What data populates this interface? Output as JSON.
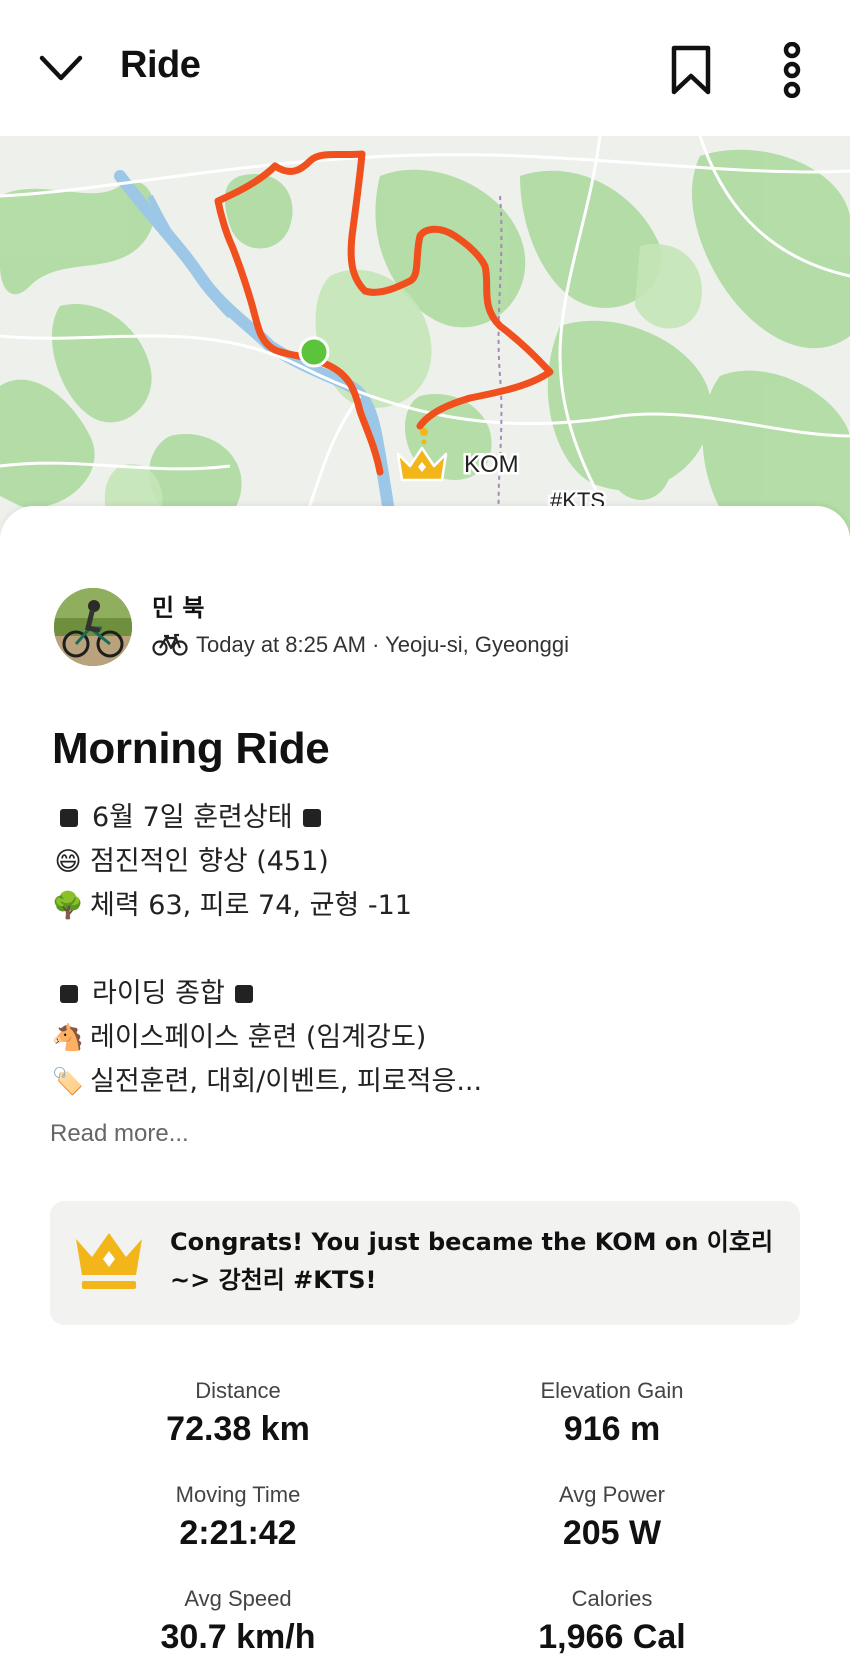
{
  "header": {
    "title": "Ride",
    "back_icon": "chevron-down-icon",
    "bookmark_icon": "bookmark-icon",
    "more_icon": "more-vertical-icon"
  },
  "map": {
    "kom_label": "KOM",
    "segment_label": "#KTS",
    "route_color": "#f0501e",
    "start_color": "#5cc43a",
    "crown_color": "#f2b61b"
  },
  "athlete": {
    "name": "민 북",
    "time_location": "Today at 8:25 AM · Yeoju-si, Gyeonggi",
    "sport_icon": "bike-icon"
  },
  "activity": {
    "title": "Morning Ride",
    "description": {
      "l1": "6월 7일 훈련상태",
      "l2_emoji": "😄",
      "l2": "점진적인 향상 (451)",
      "l3_emoji": "🌳",
      "l3": "체력 63, 피로 74, 균형 -11",
      "l4": "라이딩 종합",
      "l5_emoji": "🐴",
      "l5": "레이스페이스 훈련 (임계강도)",
      "l6_emoji": "🏷️",
      "l6": "실전훈련, 대회/이벤트, 피로적응..."
    },
    "read_more": "Read more..."
  },
  "kom": {
    "text": "Congrats! You just became the KOM on 이호리 ~> 강천리 #KTS!"
  },
  "stats": [
    {
      "label": "Distance",
      "value": "72.38 km"
    },
    {
      "label": "Elevation Gain",
      "value": "916 m"
    },
    {
      "label": "Moving Time",
      "value": "2:21:42"
    },
    {
      "label": "Avg Power",
      "value": "205 W"
    },
    {
      "label": "Avg Speed",
      "value": "30.7 km/h"
    },
    {
      "label": "Calories",
      "value": "1,966 Cal"
    }
  ]
}
